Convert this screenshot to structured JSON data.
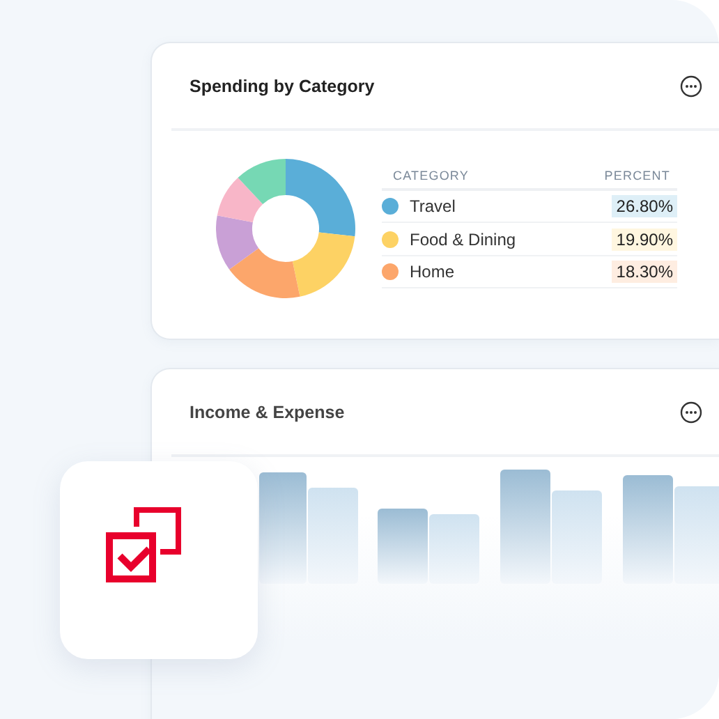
{
  "spending_card": {
    "title": "Spending by Category",
    "table": {
      "columns": [
        "CATEGORY",
        "PERCENT"
      ],
      "rows": [
        {
          "category": "Travel",
          "percent": "26.80%",
          "color": "#5aaed8"
        },
        {
          "category": "Food & Dining",
          "percent": "19.90%",
          "color": "#fdd264"
        },
        {
          "category": "Home",
          "percent": "18.30%",
          "color": "#fca66b"
        }
      ]
    }
  },
  "income_card": {
    "title": "Income & Expense"
  }
}
